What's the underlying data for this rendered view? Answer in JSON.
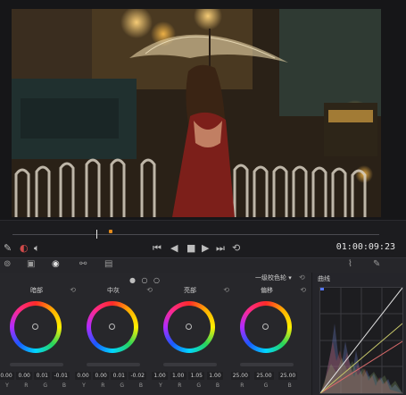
{
  "viewer": {
    "timecode": "01:00:09:23"
  },
  "toolbar": {
    "tools": [
      "camera-raw-icon",
      "color-match-icon",
      "primaries-icon",
      "hdr-icon",
      "rgb-mixer-icon"
    ]
  },
  "wheels": {
    "mode": "一级校色轮",
    "groups": [
      {
        "label": "暗部",
        "values": [
          "0.00",
          "0.00",
          "0.01",
          "-0.01"
        ],
        "channels": [
          "Y",
          "R",
          "G",
          "B"
        ]
      },
      {
        "label": "中灰",
        "values": [
          "0.00",
          "0.00",
          "0.01",
          "-0.02"
        ],
        "channels": [
          "Y",
          "R",
          "G",
          "B"
        ]
      },
      {
        "label": "亮部",
        "values": [
          "1.00",
          "1.00",
          "1.05",
          "1.00"
        ],
        "channels": [
          "Y",
          "R",
          "G",
          "B"
        ]
      },
      {
        "label": "偏移",
        "values": [
          "25.00",
          "25.00",
          "25.00",
          ""
        ],
        "channels": [
          "R",
          "G",
          "B"
        ]
      }
    ]
  },
  "curves": {
    "title": "曲线"
  }
}
